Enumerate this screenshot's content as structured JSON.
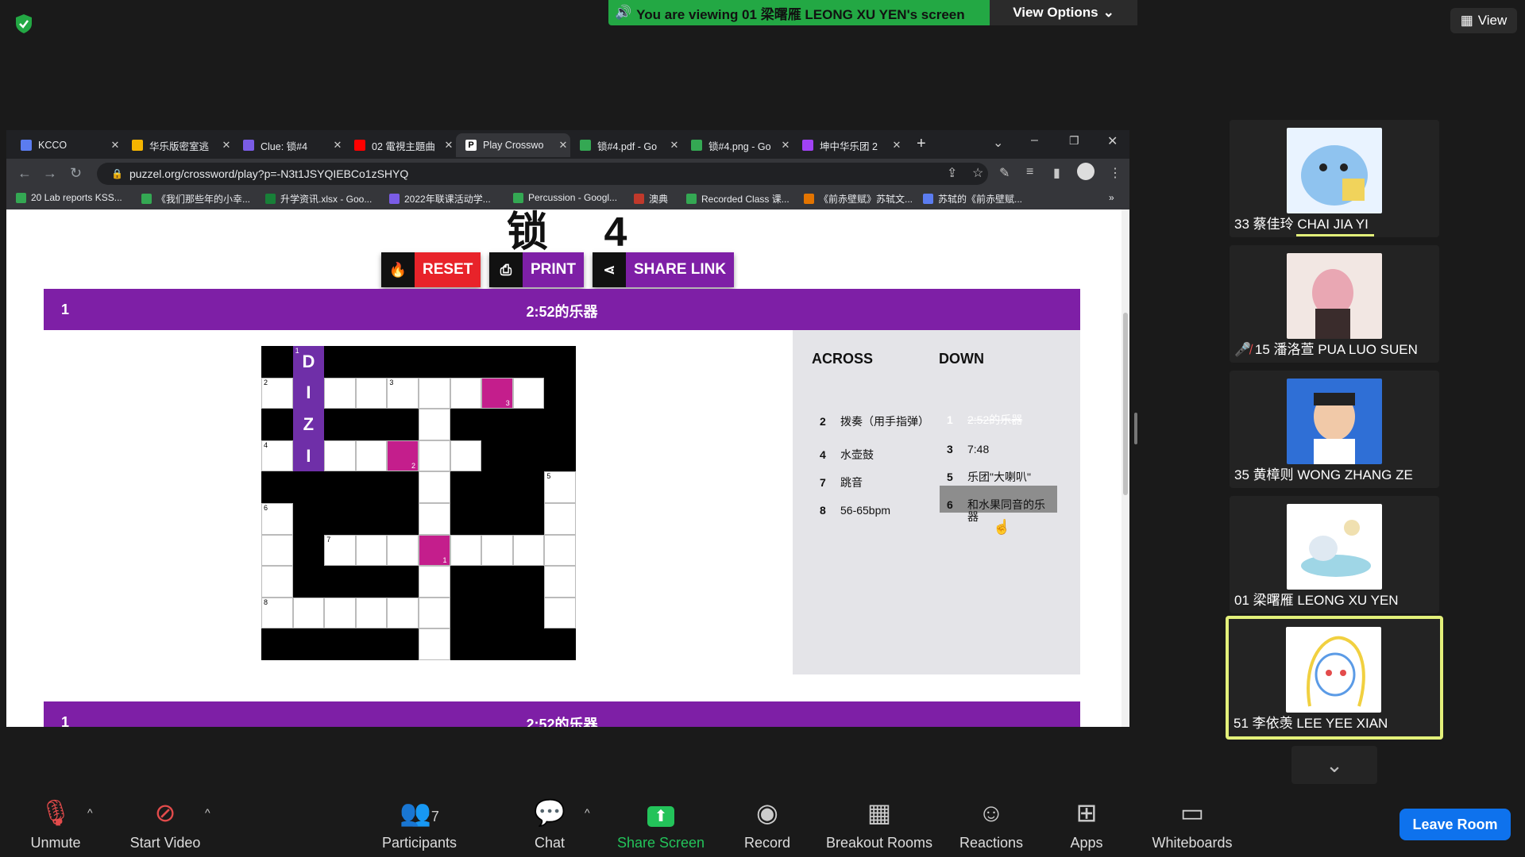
{
  "zoom": {
    "banner_text": "You are viewing 01 梁曙雁 LEONG XU YEN's screen",
    "view_options": "View Options",
    "view_label": "View",
    "leave_label": "Leave Room",
    "participants_count": "7",
    "toolbar": [
      {
        "label": "Unmute",
        "icon": "muted-mic-icon"
      },
      {
        "label": "Start Video",
        "icon": "video-off-icon"
      },
      {
        "label": "Participants",
        "icon": "participants-icon"
      },
      {
        "label": "Chat",
        "icon": "chat-icon"
      },
      {
        "label": "Share Screen",
        "icon": "share-screen-icon"
      },
      {
        "label": "Record",
        "icon": "record-icon"
      },
      {
        "label": "Breakout Rooms",
        "icon": "breakout-icon"
      },
      {
        "label": "Reactions",
        "icon": "reactions-icon"
      },
      {
        "label": "Apps",
        "icon": "apps-icon"
      },
      {
        "label": "Whiteboards",
        "icon": "whiteboard-icon"
      }
    ],
    "participants": [
      {
        "name": "33 蔡佳玲 CHAI JIA YI",
        "muted": false
      },
      {
        "name": "15 潘洛萱 PUA LUO SUEN",
        "muted": true
      },
      {
        "name": "35 黄樟则 WONG ZHANG ZE",
        "muted": false
      },
      {
        "name": "01 梁曙雁 LEONG XU YEN",
        "muted": false
      },
      {
        "name": "51 李依羡 LEE YEE XIAN",
        "muted": false,
        "active": true
      }
    ]
  },
  "browser": {
    "tabs": [
      {
        "title": "KCCO",
        "color": "#5b7cf0"
      },
      {
        "title": "华乐版密室逃",
        "color": "#f4b400"
      },
      {
        "title": "Clue: 锁#4",
        "color": "#7a5ce6"
      },
      {
        "title": "02 電視主題曲",
        "color": "#ff0000"
      },
      {
        "title": "Play Crosswo",
        "color": "#ffffff",
        "active": true
      },
      {
        "title": "锁#4.pdf - Go",
        "color": "#34a853"
      },
      {
        "title": "锁#4.png - Go",
        "color": "#34a853"
      },
      {
        "title": "坤中华乐团 2",
        "color": "#a142f4"
      }
    ],
    "url": "puzzel.org/crossword/play?p=-N3t1JSYQIEBCo1zSHYQ",
    "bookmarks": [
      "20 Lab reports KSS...",
      "《我们那些年的小幸...",
      "升学资讯.xlsx - Goo...",
      "2022年联课活动学...",
      "Percussion - Googl...",
      "澳典",
      "Recorded Class 课...",
      "《前赤壁赋》苏轼文...",
      "苏轼的《前赤壁赋..."
    ]
  },
  "puzzle": {
    "title": "锁 4",
    "buttons": {
      "reset": "RESET",
      "print": "PRINT",
      "share": "SHARE LINK"
    },
    "active_clue_num": "1",
    "active_clue_text": "2:52的乐器",
    "across_heading": "ACROSS",
    "down_heading": "DOWN",
    "across": [
      {
        "num": "2",
        "text": "拨奏（用手指弹）"
      },
      {
        "num": "4",
        "text": "水壶鼓"
      },
      {
        "num": "7",
        "text": "跳音"
      },
      {
        "num": "8",
        "text": "56-65bpm"
      }
    ],
    "down": [
      {
        "num": "1",
        "text": "2:52的乐器",
        "active": true
      },
      {
        "num": "3",
        "text": "7:48"
      },
      {
        "num": "5",
        "text": "乐团\"大喇叭\""
      },
      {
        "num": "6",
        "text": "和水果同音的乐器"
      }
    ],
    "grid": {
      "rows": [
        "BPBBBBBBBB",
        "WPWWWWWMWB",
        "BPBBBWBBBB",
        "WPWWMWWBBB",
        "BBBBBWBBBW",
        "WBBBBWBBBW",
        "WBWWWMWWWW",
        "WBBBBWBBBW",
        "WWWWWWBBBW",
        "BBBBBWBBBB"
      ],
      "letters": {
        "0,1": "D",
        "1,1": "I",
        "2,1": "Z",
        "3,1": "I"
      },
      "numbers": {
        "0,1": "1",
        "1,0": "2",
        "1,4": "3",
        "3,0": "4",
        "4,9": "5",
        "5,0": "6",
        "6,2": "7",
        "8,0": "8"
      },
      "marks": {
        "1,7": "3",
        "3,4": "2",
        "6,5": "1"
      }
    }
  }
}
